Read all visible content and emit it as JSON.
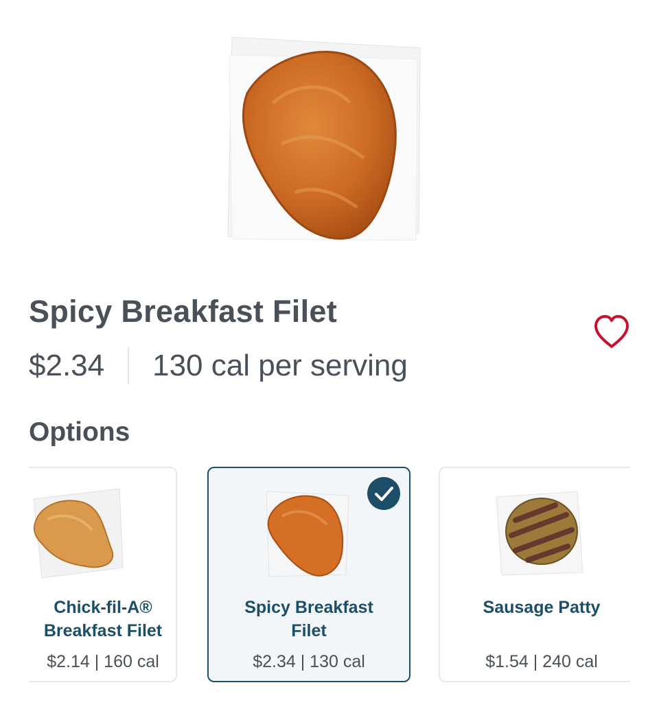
{
  "product": {
    "title": "Spicy Breakfast Filet",
    "price": "$2.34",
    "calories": "130 cal per serving",
    "hero_image": "spicy-breakfast-filet-image",
    "favorite_icon": "heart-outline-icon",
    "favorite_color": "#c8102e"
  },
  "options": {
    "heading": "Options",
    "items": [
      {
        "name_line1": "Chick-fil-A®",
        "name_line2": "Breakfast Filet",
        "meta": "$2.14 | 160 cal",
        "selected": false,
        "image": "breakfast-filet-image"
      },
      {
        "name_line1": "Spicy Breakfast",
        "name_line2": "Filet",
        "meta": "$2.34 | 130 cal",
        "selected": true,
        "image": "spicy-breakfast-filet-image"
      },
      {
        "name_line1": "Sausage Patty",
        "name_line2": "",
        "meta": "$1.54 | 240 cal",
        "selected": false,
        "image": "sausage-patty-image"
      }
    ],
    "selected_icon": "checkmark-circle-icon",
    "accent_color": "#1c4f67"
  }
}
